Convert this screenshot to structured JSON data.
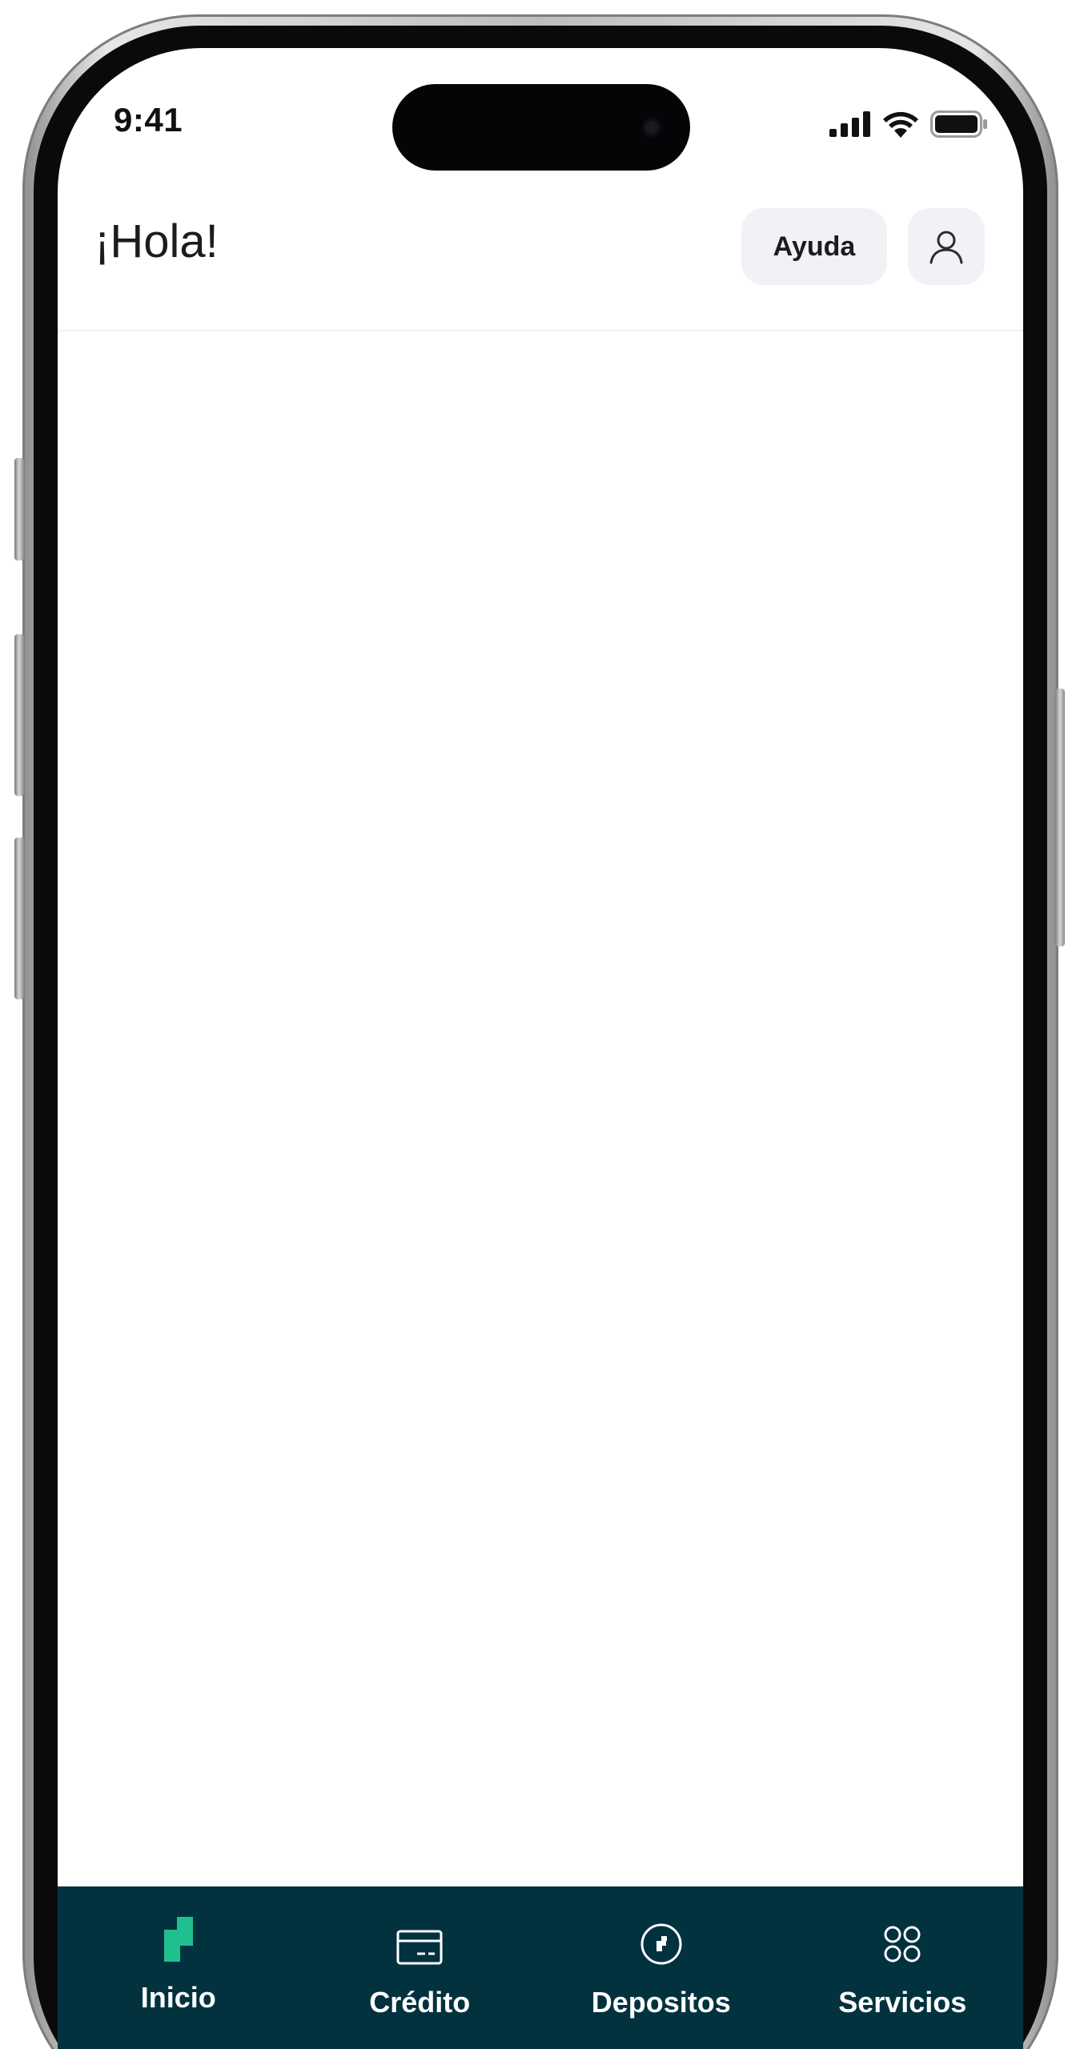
{
  "status_bar": {
    "time": "9:41"
  },
  "header": {
    "greeting": "¡Hola!",
    "help_label": "Ayuda",
    "profile_icon": "user-icon"
  },
  "tab_bar": {
    "background": "#03323f",
    "accent": "#1fbf8f",
    "tabs": [
      {
        "label": "Inicio",
        "icon": "home-logo-icon",
        "active": true
      },
      {
        "label": "Crédito",
        "icon": "credit-card-icon",
        "active": false
      },
      {
        "label": "Depositos",
        "icon": "deposit-coin-icon",
        "active": false
      },
      {
        "label": "Servicios",
        "icon": "grid-circles-icon",
        "active": false
      }
    ]
  }
}
